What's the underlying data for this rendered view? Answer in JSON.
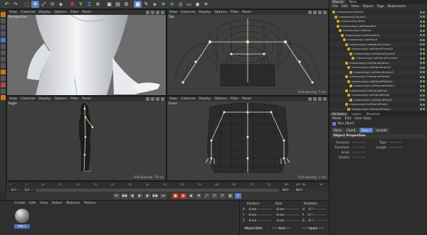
{
  "toolbar": {
    "icons": [
      "undo-icon",
      "redo-icon",
      "select-icon",
      "move-icon",
      "scale-icon",
      "rotate-icon",
      "model-icon",
      "x-axis-icon",
      "y-axis-icon",
      "z-axis-icon",
      "coord-icon",
      "render-icon",
      "render-view-icon",
      "render-settings-icon",
      "cube-icon",
      "pen-icon",
      "subdivision-icon",
      "array-icon",
      "cloner-icon",
      "deformer-icon",
      "floor-icon",
      "camera-icon",
      "light-icon"
    ]
  },
  "viewports": {
    "menu": [
      "View",
      "Cameras",
      "Display",
      "Options",
      "Filter",
      "Panel"
    ],
    "perspective": {
      "name": "Perspective",
      "grid": ""
    },
    "top": {
      "name": "Top",
      "grid": "Grid Spacing : 5 cm"
    },
    "right": {
      "name": "Right",
      "grid": "Grid Spacing : 50 cm"
    },
    "front": {
      "name": "Front",
      "grid": "Grid Spacing : 5 cm"
    }
  },
  "timeline": {
    "ticks": [
      "0",
      "5",
      "10",
      "15",
      "20",
      "25",
      "30",
      "35",
      "40",
      "45",
      "50",
      "55",
      "60",
      "65",
      "70",
      "75",
      "80",
      "85",
      "90"
    ],
    "start": "0 F",
    "current": "0 F",
    "end_frame": "90 F",
    "max_frame": "90 F",
    "frame_readout": "0 F"
  },
  "material_manager": {
    "menu": [
      "Create",
      "Edit",
      "View",
      "Select",
      "Material",
      "Texture"
    ],
    "material_name": "Mat.1"
  },
  "coord_manager": {
    "headers": [
      "Position",
      "Size",
      "Rotation"
    ],
    "rows": [
      {
        "axis": "X",
        "pos": "0 cm",
        "size": "0 cm",
        "rot_axis": "H",
        "rot": "0 °"
      },
      {
        "axis": "Y",
        "pos": "0 cm",
        "size": "0 cm",
        "rot_axis": "P",
        "rot": "0 °"
      },
      {
        "axis": "Z",
        "pos": "0 cm",
        "size": "0 cm",
        "rot_axis": "B",
        "rot": "0 °"
      }
    ],
    "mode": "Object (Rel)",
    "size_mode": "Size",
    "apply": "Apply"
  },
  "object_manager": {
    "tabs": [
      "Objects",
      "Takes"
    ],
    "menu": [
      "File",
      "Edit",
      "View",
      "Object",
      "Tags",
      "Bookmarks"
    ],
    "items": [
      {
        "name": "mixamorig1:Spine2",
        "indent": 0
      },
      {
        "name": "mixamorig1:Spine2",
        "indent": 1
      },
      {
        "name": "mixamorig1:Neck",
        "indent": 2
      },
      {
        "name": "mixamorig1:LeftShoulder",
        "indent": 2
      },
      {
        "name": "mixamorig1:LeftArm",
        "indent": 3
      },
      {
        "name": "mixamorig1:LeftForeArm",
        "indent": 4
      },
      {
        "name": "mixamorig1:LeftHand",
        "indent": 5
      },
      {
        "name": "mixamorig1:LeftHandThumb1",
        "indent": 6
      },
      {
        "name": "mixamorig1:LeftHandThumb2",
        "indent": 7
      },
      {
        "name": "mixamorig1:LeftHandThumb3",
        "indent": 8
      },
      {
        "name": "mixamorig1:LeftHandThumb4",
        "indent": 9
      },
      {
        "name": "mixamorig1:LeftHandIndex1",
        "indent": 6
      },
      {
        "name": "mixamorig1:LeftHandIndex2",
        "indent": 7
      },
      {
        "name": "mixamorig1:LeftHandIndex3",
        "indent": 8
      },
      {
        "name": "mixamorig1:LeftHandMiddle1",
        "indent": 6
      },
      {
        "name": "mixamorig1:LeftHandMiddle2",
        "indent": 7
      },
      {
        "name": "mixamorig1:LeftHandMiddle3",
        "indent": 8
      },
      {
        "name": "mixamorig1:LeftHandRing1",
        "indent": 6
      },
      {
        "name": "mixamorig1:LeftHandRing2",
        "indent": 7
      },
      {
        "name": "mixamorig1:LeftHandRing3",
        "indent": 8
      },
      {
        "name": "mixamorig1:LeftHandPinky1",
        "indent": 6
      },
      {
        "name": "mixamorig1:LeftHandPinky2",
        "indent": 7
      }
    ]
  },
  "attribute_manager": {
    "tabs": [
      "Attributes",
      "Layers",
      "Structure"
    ],
    "menu": [
      "Mode",
      "Edit",
      "User Data"
    ],
    "title": "Skin [Skin]",
    "subtabs": [
      "Basic",
      "Coord.",
      "Object",
      "Include"
    ],
    "active_subtab": "Object",
    "section": "Object Properties",
    "props": [
      {
        "label": "Accuracy",
        "value": "",
        "label2": "Type"
      },
      {
        "label": "Transform",
        "value": "",
        "label2": "Length"
      },
      {
        "label": "Scale",
        "value": "",
        "label2": ""
      },
      {
        "label": "Stretch",
        "value": "",
        "label2": ""
      }
    ]
  },
  "colors": {
    "accent": "#4d78bf",
    "record": "#b53a2e",
    "null_icon": "#d3a232",
    "bone": "#e8e6c8"
  }
}
